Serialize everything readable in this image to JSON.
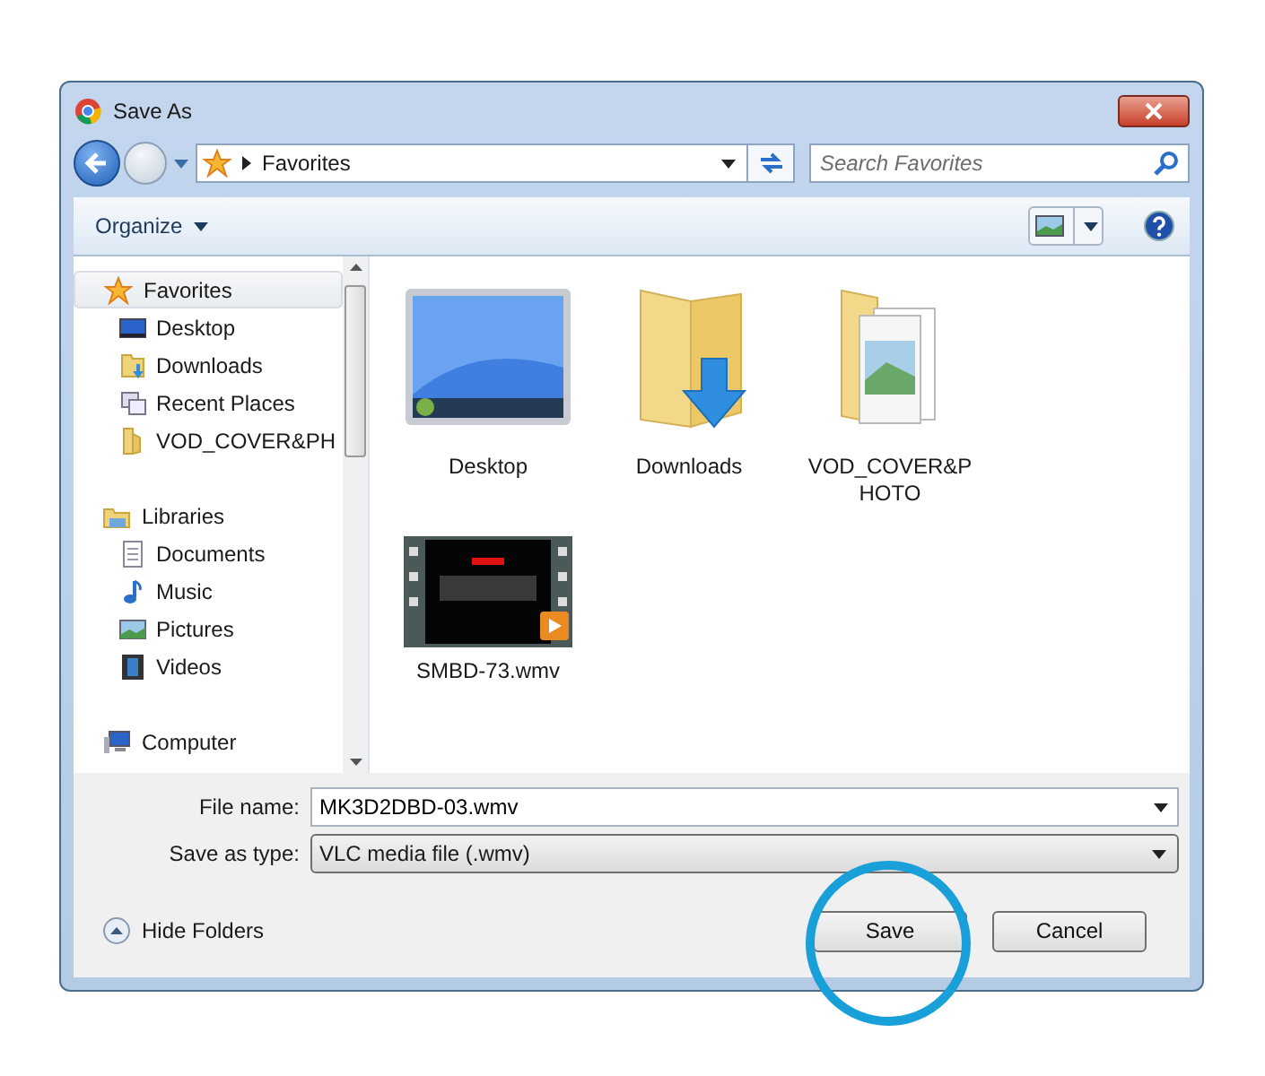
{
  "window": {
    "title": "Save As"
  },
  "address": {
    "location": "Favorites"
  },
  "search": {
    "placeholder": "Search Favorites"
  },
  "toolbar": {
    "organize": "Organize"
  },
  "sidebar": {
    "groups": [
      {
        "label": "Favorites",
        "kind": "star",
        "selected": true,
        "children": [
          {
            "label": "Desktop",
            "kind": "desktop",
            "selected": false
          },
          {
            "label": "Downloads",
            "kind": "downloads",
            "selected": false
          },
          {
            "label": "Recent Places",
            "kind": "recent",
            "selected": false
          },
          {
            "label": "VOD_COVER&PH",
            "kind": "folder",
            "selected": false
          }
        ]
      },
      {
        "label": "Libraries",
        "kind": "library",
        "selected": false,
        "children": [
          {
            "label": "Documents",
            "kind": "documents",
            "selected": false
          },
          {
            "label": "Music",
            "kind": "music",
            "selected": false
          },
          {
            "label": "Pictures",
            "kind": "pictures",
            "selected": false
          },
          {
            "label": "Videos",
            "kind": "videos",
            "selected": false
          }
        ]
      },
      {
        "label": "Computer",
        "kind": "computer",
        "selected": false
      }
    ]
  },
  "files": [
    {
      "name": "Desktop",
      "kind": "desktop"
    },
    {
      "name": "Downloads",
      "kind": "downloads"
    },
    {
      "name": "VOD_COVER&PHOTO",
      "kind": "folder"
    },
    {
      "name": "SMBD-73.wmv",
      "kind": "video"
    }
  ],
  "file_name": {
    "label": "File name:",
    "value": "MK3D2DBD-03.wmv"
  },
  "save_as_type": {
    "label": "Save as type:",
    "value": "VLC media file (.wmv)"
  },
  "hide_folders": {
    "label": "Hide Folders"
  },
  "buttons": [
    {
      "label": "Save",
      "circled": true
    },
    {
      "label": "Cancel",
      "circled": false
    }
  ]
}
